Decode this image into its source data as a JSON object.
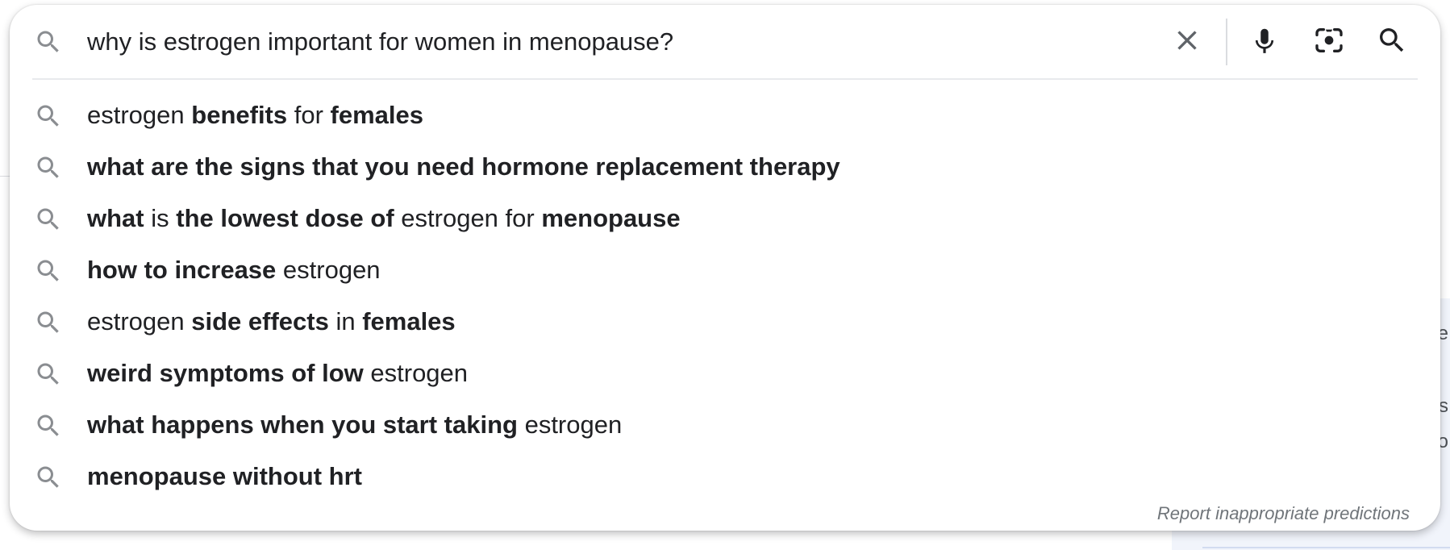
{
  "search": {
    "query": "why is estrogen important for women in menopause?",
    "icons": {
      "lead": "search-icon",
      "clear": "close-icon",
      "voice": "microphone-icon",
      "lens": "camera-lens-icon",
      "submit": "search-icon"
    }
  },
  "suggestions": [
    {
      "parts": [
        {
          "t": "estrogen ",
          "b": false
        },
        {
          "t": "benefits",
          "b": true
        },
        {
          "t": " for ",
          "b": false
        },
        {
          "t": "females",
          "b": true
        }
      ]
    },
    {
      "parts": [
        {
          "t": "what are the signs that you need hormone replacement therapy",
          "b": true
        }
      ]
    },
    {
      "parts": [
        {
          "t": "what",
          "b": true
        },
        {
          "t": " is ",
          "b": false
        },
        {
          "t": "the lowest dose of",
          "b": true
        },
        {
          "t": " estrogen for ",
          "b": false
        },
        {
          "t": "menopause",
          "b": true
        }
      ]
    },
    {
      "parts": [
        {
          "t": "how to increase",
          "b": true
        },
        {
          "t": " estrogen",
          "b": false
        }
      ]
    },
    {
      "parts": [
        {
          "t": "estrogen ",
          "b": false
        },
        {
          "t": "side effects",
          "b": true
        },
        {
          "t": " in ",
          "b": false
        },
        {
          "t": "females",
          "b": true
        }
      ]
    },
    {
      "parts": [
        {
          "t": "weird symptoms of low",
          "b": true
        },
        {
          "t": " estrogen",
          "b": false
        }
      ]
    },
    {
      "parts": [
        {
          "t": "what happens when you start taking",
          "b": true
        },
        {
          "t": " estrogen",
          "b": false
        }
      ]
    },
    {
      "parts": [
        {
          "t": "menopause without hrt",
          "b": true
        }
      ]
    }
  ],
  "footer": {
    "report_label": "Report inappropriate predictions"
  },
  "background": {
    "glyphs": [
      "e",
      "s",
      "o"
    ]
  },
  "colors": {
    "text": "#202124",
    "icon": "#5f6368",
    "muted": "#70757a",
    "divider": "#dadce0"
  }
}
